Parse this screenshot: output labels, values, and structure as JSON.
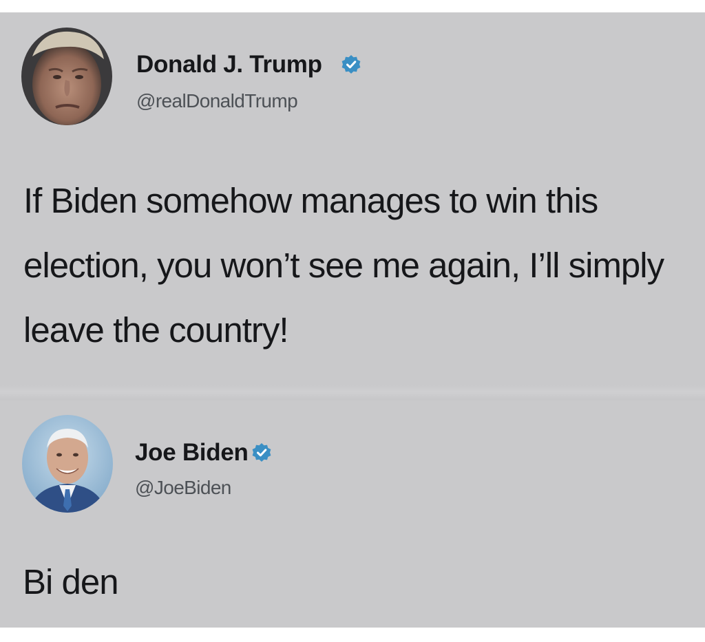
{
  "tweets": [
    {
      "display_name": "Donald J. Trump",
      "handle": "@realDonaldTrump",
      "verified": true,
      "text": "If Biden somehow manages to win this election, you won’t see me again, I’ll simply leave the country!"
    },
    {
      "display_name": "Joe Biden",
      "handle": "@JoeBiden",
      "verified": true,
      "text": "Bi den"
    }
  ],
  "colors": {
    "background": "#c9c9cb",
    "text": "#16171a",
    "handle": "#4d5156",
    "verified_badge": "#3a8fc4"
  },
  "icons": {
    "verified": "verified-badge-icon",
    "avatar_1": "profile-photo",
    "avatar_2": "profile-photo"
  }
}
